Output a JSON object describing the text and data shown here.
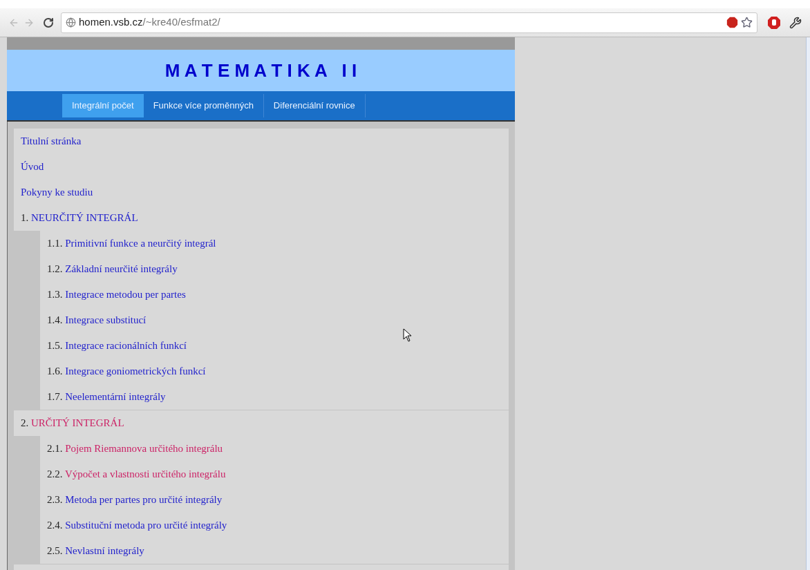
{
  "browser": {
    "url_host": "homen.vsb.cz",
    "url_path": "/~kre40/esfmat2/"
  },
  "header": {
    "title": "M A T E M A T I K A   I I"
  },
  "tabs": [
    {
      "label": "Integrální počet",
      "selected": true
    },
    {
      "label": "Funkce více proměnných",
      "selected": false
    },
    {
      "label": "Diferenciální rovnice",
      "selected": false
    }
  ],
  "contents": [
    {
      "label": "Titulní stránka",
      "visited": false
    },
    {
      "label": "Úvod",
      "visited": false
    },
    {
      "label": "Pokyny ke studiu",
      "visited": false
    },
    {
      "number": "1.",
      "label": "NEURČITÝ INTEGRÁL",
      "visited": false,
      "children": [
        {
          "number": "1.1.",
          "label": "Primitivní funkce a neurčitý integrál",
          "visited": false
        },
        {
          "number": "1.2.",
          "label": "Základní neurčité integrály",
          "visited": false
        },
        {
          "number": "1.3.",
          "label": "Integrace metodou per partes",
          "visited": false
        },
        {
          "number": "1.4.",
          "label": "Integrace substitucí",
          "visited": false
        },
        {
          "number": "1.5.",
          "label": "Integrace racionálních funkcí",
          "visited": false
        },
        {
          "number": "1.6.",
          "label": "Integrace goniometrických funkcí",
          "visited": false
        },
        {
          "number": "1.7.",
          "label": "Neelementární integrály",
          "visited": false
        }
      ]
    },
    {
      "number": "2.",
      "label": "URČITÝ INTEGRÁL",
      "visited": true,
      "children": [
        {
          "number": "2.1.",
          "label": "Pojem Riemannova určitého integrálu",
          "visited": true
        },
        {
          "number": "2.2.",
          "label": "Výpočet a vlastnosti určitého integrálu",
          "visited": true
        },
        {
          "number": "2.3.",
          "label": "Metoda per partes pro určité integrály",
          "visited": false
        },
        {
          "number": "2.4.",
          "label": "Substituční metoda pro určité integrály",
          "visited": false
        },
        {
          "number": "2.5.",
          "label": "Nevlastní integrály",
          "visited": false
        }
      ]
    }
  ]
}
